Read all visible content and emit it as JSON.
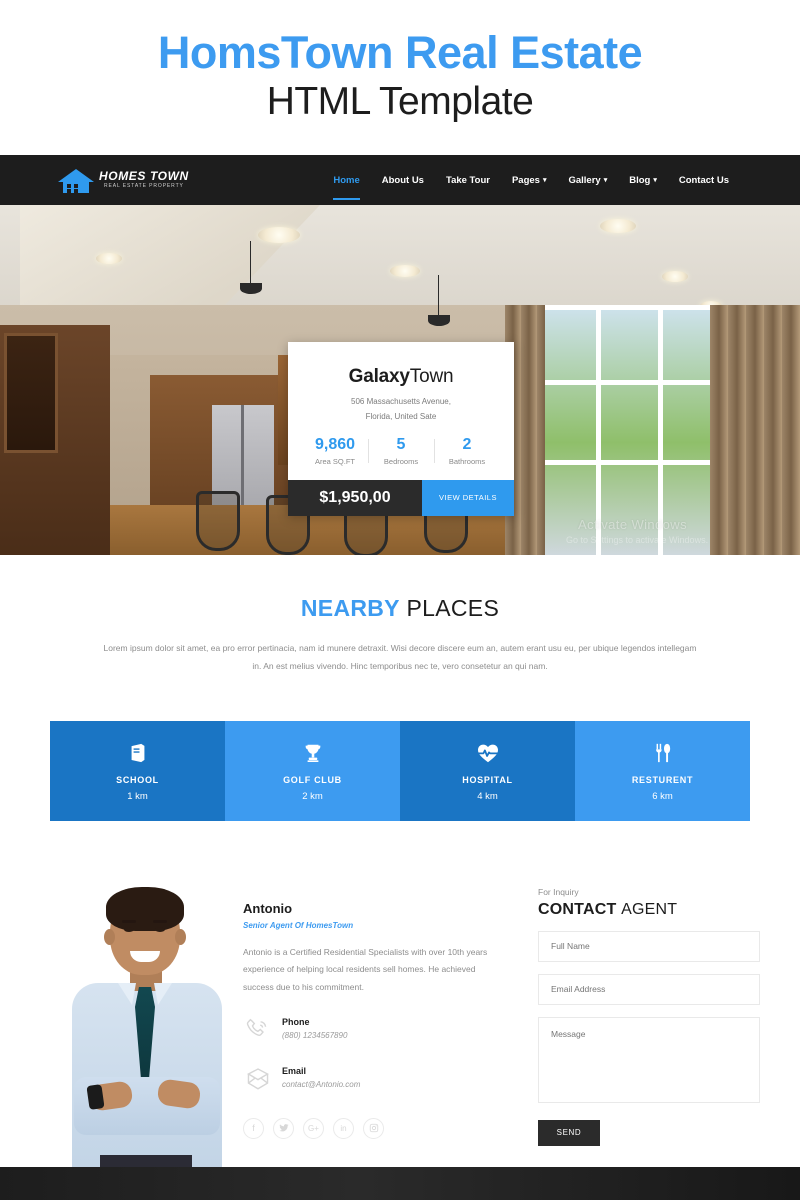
{
  "promo": {
    "line1": "HomsTown Real Estate",
    "line2": "HTML Template"
  },
  "navbar": {
    "logo_name": "HOMES TOWN",
    "logo_sub": "REAL ESTATE PROPERTY",
    "items": [
      {
        "label": "Home",
        "active": true,
        "caret": ""
      },
      {
        "label": "About Us",
        "active": false,
        "caret": ""
      },
      {
        "label": "Take Tour",
        "active": false,
        "caret": ""
      },
      {
        "label": "Pages",
        "active": false,
        "caret": "▾"
      },
      {
        "label": "Gallery",
        "active": false,
        "caret": "▾"
      },
      {
        "label": "Blog",
        "active": false,
        "caret": "▾"
      },
      {
        "label": "Contact Us",
        "active": false,
        "caret": ""
      }
    ]
  },
  "hero": {
    "watermark_line1": "Activate Windows",
    "watermark_line2": "Go to Settings to activate Windows.",
    "property": {
      "title_bold": "Galaxy",
      "title_light": "Town",
      "address_line1": "506 Massachusetts Avenue,",
      "address_line2": "Florida, United Sate",
      "stats": [
        {
          "value": "9,860",
          "label": "Area SQ.FT"
        },
        {
          "value": "5",
          "label": "Bedrooms"
        },
        {
          "value": "2",
          "label": "Bathrooms"
        }
      ],
      "price": "$1,950,00",
      "cta": "VIEW DETAILS"
    }
  },
  "nearby": {
    "title_bold": "NEARBY",
    "title_light": "PLACES",
    "description": "Lorem ipsum dolor sit amet, ea pro error pertinacia, nam id munere detraxit. Wisi decore discere eum an, autem erant usu eu, per ubique legendos intellegam in. An est melius vivendo. Hinc temporibus nec te, vero consetetur an qui nam.",
    "cards": [
      {
        "icon": "book-icon",
        "name": "SCHOOL",
        "distance": "1 km",
        "color": "#1a75c4"
      },
      {
        "icon": "trophy-icon",
        "name": "GOLF CLUB",
        "distance": "2 km",
        "color": "#3d9bf0"
      },
      {
        "icon": "heartbeat-icon",
        "name": "HOSPITAL",
        "distance": "4 km",
        "color": "#1a75c4"
      },
      {
        "icon": "cutlery-icon",
        "name": "RESTURENT",
        "distance": "6 km",
        "color": "#3d9bf0"
      }
    ]
  },
  "agent": {
    "name": "Antonio",
    "role": "Senior Agent Of HomesTown",
    "bio": "Antonio is a Certified Residential Specialists with over 10th years experience of helping local residents sell homes. He achieved success due to his commitment.",
    "phone_label": "Phone",
    "phone_value": "(880) 1234567890",
    "email_label": "Email",
    "email_value": "contact@Antonio.com",
    "socials": [
      {
        "icon": "facebook-icon",
        "glyph": "f"
      },
      {
        "icon": "twitter-icon",
        "glyph": "❦"
      },
      {
        "icon": "google-plus-icon",
        "glyph": "G+"
      },
      {
        "icon": "linkedin-icon",
        "glyph": "in"
      },
      {
        "icon": "instagram-icon",
        "glyph": "▣"
      }
    ]
  },
  "form": {
    "eyebrow": "For Inquiry",
    "title_bold": "CONTACT",
    "title_light": "AGENT",
    "name_placeholder": "Full Name",
    "email_placeholder": "Email Address",
    "message_placeholder": "Message",
    "send_label": "SEND"
  },
  "colors": {
    "accent_blue": "#3d9bf0",
    "deep_blue": "#1a75c4",
    "dark": "#1d1d1d",
    "price_bg": "#2b2b2b"
  }
}
